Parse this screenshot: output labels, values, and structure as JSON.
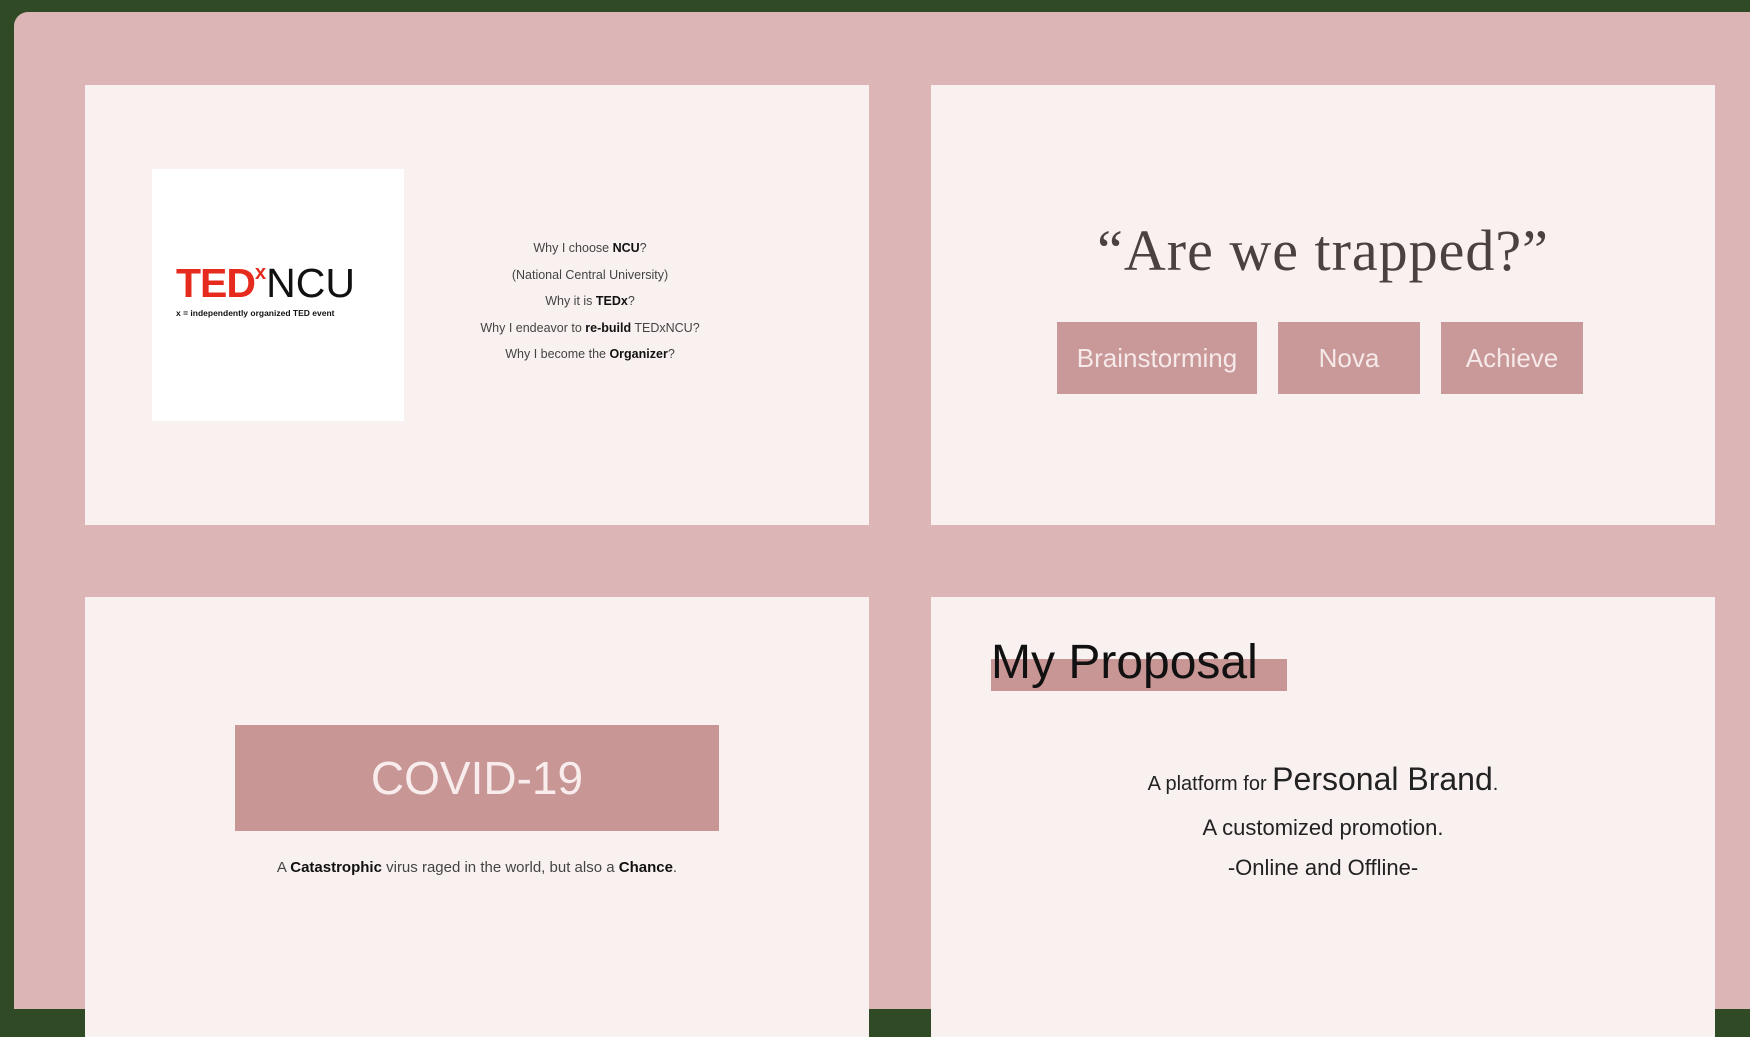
{
  "slide1": {
    "logo": {
      "ted": "TED",
      "x": "x",
      "ncu": "NCU",
      "tagline": "x = independently organized TED event"
    },
    "why": {
      "line1_a": "Why I choose ",
      "line1_b": "NCU",
      "line1_c": "?",
      "line2": "(National Central University)",
      "line3_a": "Why it is ",
      "line3_b": "TEDx",
      "line3_c": "?",
      "line4_a": "Why I endeavor to ",
      "line4_b": "re-build",
      "line4_c": " TEDxNCU?",
      "line5_a": "Why I become the ",
      "line5_b": "Organizer",
      "line5_c": "?"
    }
  },
  "slide2": {
    "quote": "“Are we trapped?”",
    "tags": [
      "Brainstorming",
      "Nova",
      "Achieve"
    ]
  },
  "slide3": {
    "title": "COVID-19",
    "caption_a": "A ",
    "caption_b": "Catastrophic",
    "caption_c": " virus raged in the world, but also a ",
    "caption_d": "Chance",
    "caption_e": "."
  },
  "slide4": {
    "title": "My Proposal",
    "line1_a": "A platform for ",
    "line1_b": "Personal Brand",
    "line1_c": ".",
    "line2": "A customized promotion.",
    "line3": "-Online and Offline-"
  },
  "colors": {
    "frame": "#dcb6b6",
    "slide_bg": "#f8f1f0",
    "accent": "#c99898",
    "ted_red": "#e62b1e"
  }
}
